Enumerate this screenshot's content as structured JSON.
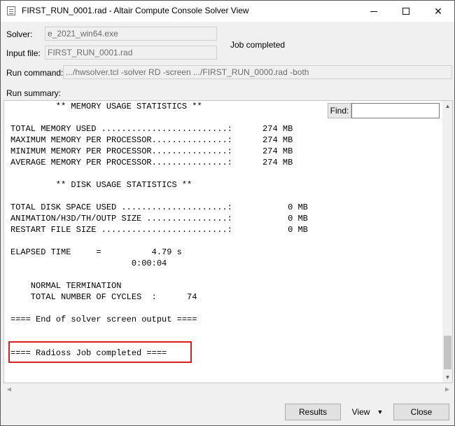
{
  "window": {
    "title": "FIRST_RUN_0001.rad - Altair Compute Console Solver View"
  },
  "form": {
    "solver_label": "Solver:",
    "solver_value": "e_2021_win64.exe",
    "input_file_label": "Input file:",
    "input_file_value": "FIRST_RUN_0001.rad",
    "status_text": "Job completed",
    "run_command_label": "Run command:",
    "run_command_value": ".../hwsolver.tcl -solver RD -screen .../FIRST_RUN_0000.rad -both",
    "run_summary_label": "Run summary:"
  },
  "find": {
    "label": "Find:",
    "value": ""
  },
  "console": {
    "lines": [
      "         ** MEMORY USAGE STATISTICS **",
      "",
      "TOTAL MEMORY USED .........................:      274 MB",
      "MAXIMUM MEMORY PER PROCESSOR...............:      274 MB",
      "MINIMUM MEMORY PER PROCESSOR...............:      274 MB",
      "AVERAGE MEMORY PER PROCESSOR...............:      274 MB",
      "",
      "         ** DISK USAGE STATISTICS **",
      "",
      "TOTAL DISK SPACE USED .....................:           0 MB",
      "ANIMATION/H3D/TH/OUTP SIZE ................:           0 MB",
      "RESTART FILE SIZE .........................:           0 MB",
      "",
      "ELAPSED TIME     =          4.79 s",
      "                        0:00:04",
      "",
      "    NORMAL TERMINATION",
      "    TOTAL NUMBER OF CYCLES  :      74",
      "",
      "==== End of solver screen output ====",
      "",
      "",
      "==== Radioss Job completed ===="
    ]
  },
  "buttons": {
    "results": "Results",
    "view": "View",
    "close": "Close"
  },
  "colors": {
    "highlight": "#d61f26"
  }
}
